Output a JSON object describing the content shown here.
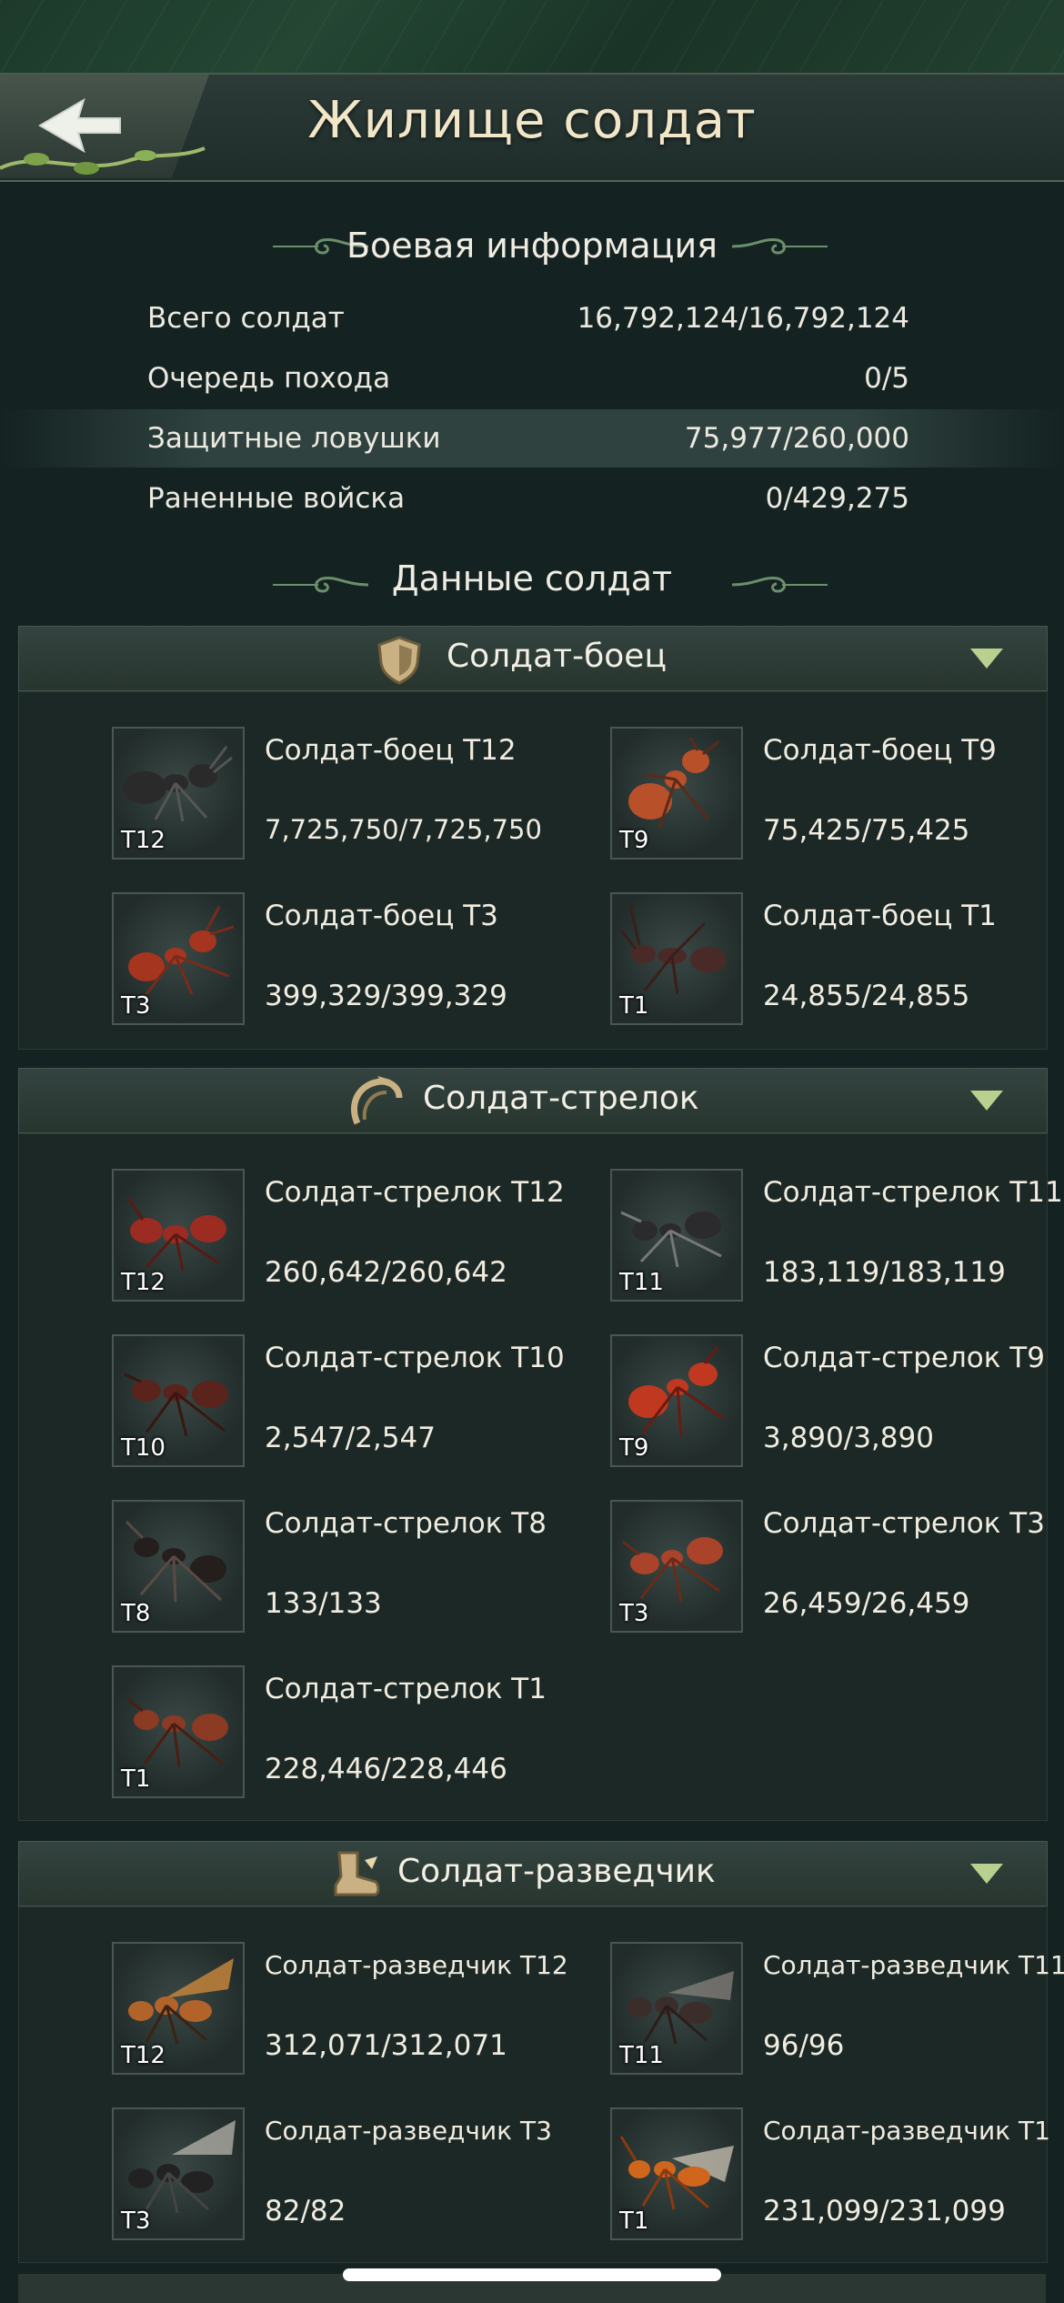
{
  "header": {
    "title": "Жилище солдат"
  },
  "battle_info": {
    "title": "Боевая информация",
    "rows": [
      {
        "label": "Всего солдат",
        "value": "16,792,124/16,792,124"
      },
      {
        "label": "Очередь похода",
        "value": "0/5"
      },
      {
        "label": "Защитные ловушки",
        "value": "75,977/260,000"
      },
      {
        "label": "Раненные войска",
        "value": "0/429,275"
      }
    ]
  },
  "soldier_data": {
    "title": "Данные солдат"
  },
  "categories": [
    {
      "label": "Солдат-боец",
      "icon": "shield-icon",
      "units": [
        {
          "name": "Солдат-боец T12",
          "count": "7,725,750/7,725,750",
          "tier": "T12",
          "color": "#2a2a2a"
        },
        {
          "name": "Солдат-боец T9",
          "count": "75,425/75,425",
          "tier": "T9",
          "color": "#b8502a"
        },
        {
          "name": "Солдат-боец T3",
          "count": "399,329/399,329",
          "tier": "T3",
          "color": "#a5351f"
        },
        {
          "name": "Солдат-боец T1",
          "count": "24,855/24,855",
          "tier": "T1",
          "color": "#4a2a26"
        }
      ]
    },
    {
      "label": "Солдат-стрелок",
      "icon": "bow-icon",
      "units": [
        {
          "name": "Солдат-стрелок T12",
          "count": "260,642/260,642",
          "tier": "T12",
          "color": "#9c2b22"
        },
        {
          "name": "Солдат-стрелок T11",
          "count": "183,119/183,119",
          "tier": "T11",
          "color": "#2b2b2e"
        },
        {
          "name": "Солдат-стрелок T10",
          "count": "2,547/2,547",
          "tier": "T10",
          "color": "#5a231c"
        },
        {
          "name": "Солдат-стрелок T9",
          "count": "3,890/3,890",
          "tier": "T9",
          "color": "#c0381f"
        },
        {
          "name": "Солдат-стрелок T8",
          "count": "133/133",
          "tier": "T8",
          "color": "#241e1c"
        },
        {
          "name": "Солдат-стрелок T3",
          "count": "26,459/26,459",
          "tier": "T3",
          "color": "#a9432a"
        },
        {
          "name": "Солдат-стрелок T1",
          "count": "228,446/228,446",
          "tier": "T1",
          "color": "#8b3a24"
        }
      ]
    },
    {
      "label": "Солдат-разведчик",
      "icon": "boot-icon",
      "units": [
        {
          "name": "Солдат-разведчик T12",
          "count": "312,071/312,071",
          "tier": "T12",
          "color": "#b2632a"
        },
        {
          "name": "Солдат-разведчик T11",
          "count": "96/96",
          "tier": "T11",
          "color": "#3a2d2a"
        },
        {
          "name": "Солдат-разведчик T3",
          "count": "82/82",
          "tier": "T3",
          "color": "#222222"
        },
        {
          "name": "Солдат-разведчик T1",
          "count": "231,099/231,099",
          "tier": "T1",
          "color": "#d0651c"
        }
      ]
    }
  ]
}
